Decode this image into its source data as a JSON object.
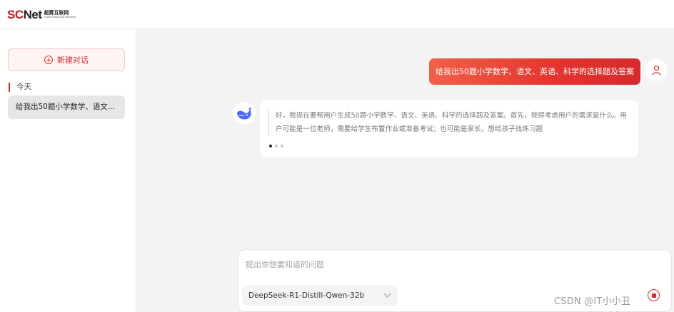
{
  "header": {
    "logo_text_sc": "SC",
    "logo_text_net": "Net",
    "logo_cn": "超算互联网",
    "logo_en": "Supercomputing Network"
  },
  "sidebar": {
    "new_chat_label": "新建对话",
    "section_today": "今天",
    "history_items": [
      {
        "label": "给我出50题小学数学、语文..."
      }
    ]
  },
  "chat": {
    "user_message": "给我出50题小学数学、语文、英语、科学的选择题及答案",
    "assistant_thinking": "好，我现在要帮用户生成50题小学数学、语文、英语、科学的选择题及答案。首先，我得考虑用户的需求是什么。用户可能是一位老师，需要给学生布置作业或准备考试；也可能是家长，想给孩子找练习题"
  },
  "input": {
    "placeholder": "提出你想要知道的问题",
    "model_selected": "DeepSeek-R1-Distill-Qwen-32b"
  },
  "watermark": "CSDN @IT小小丑",
  "colors": {
    "accent": "#d72828",
    "user_bubble_start": "#f06049",
    "user_bubble_end": "#d52a2e",
    "bot_blue": "#4d6bfe"
  },
  "icons": {
    "new_chat": "plus-circle-icon",
    "user": "user-icon",
    "assistant": "whale-icon",
    "model_dropdown": "chevron-down-icon",
    "stop": "stop-icon"
  }
}
